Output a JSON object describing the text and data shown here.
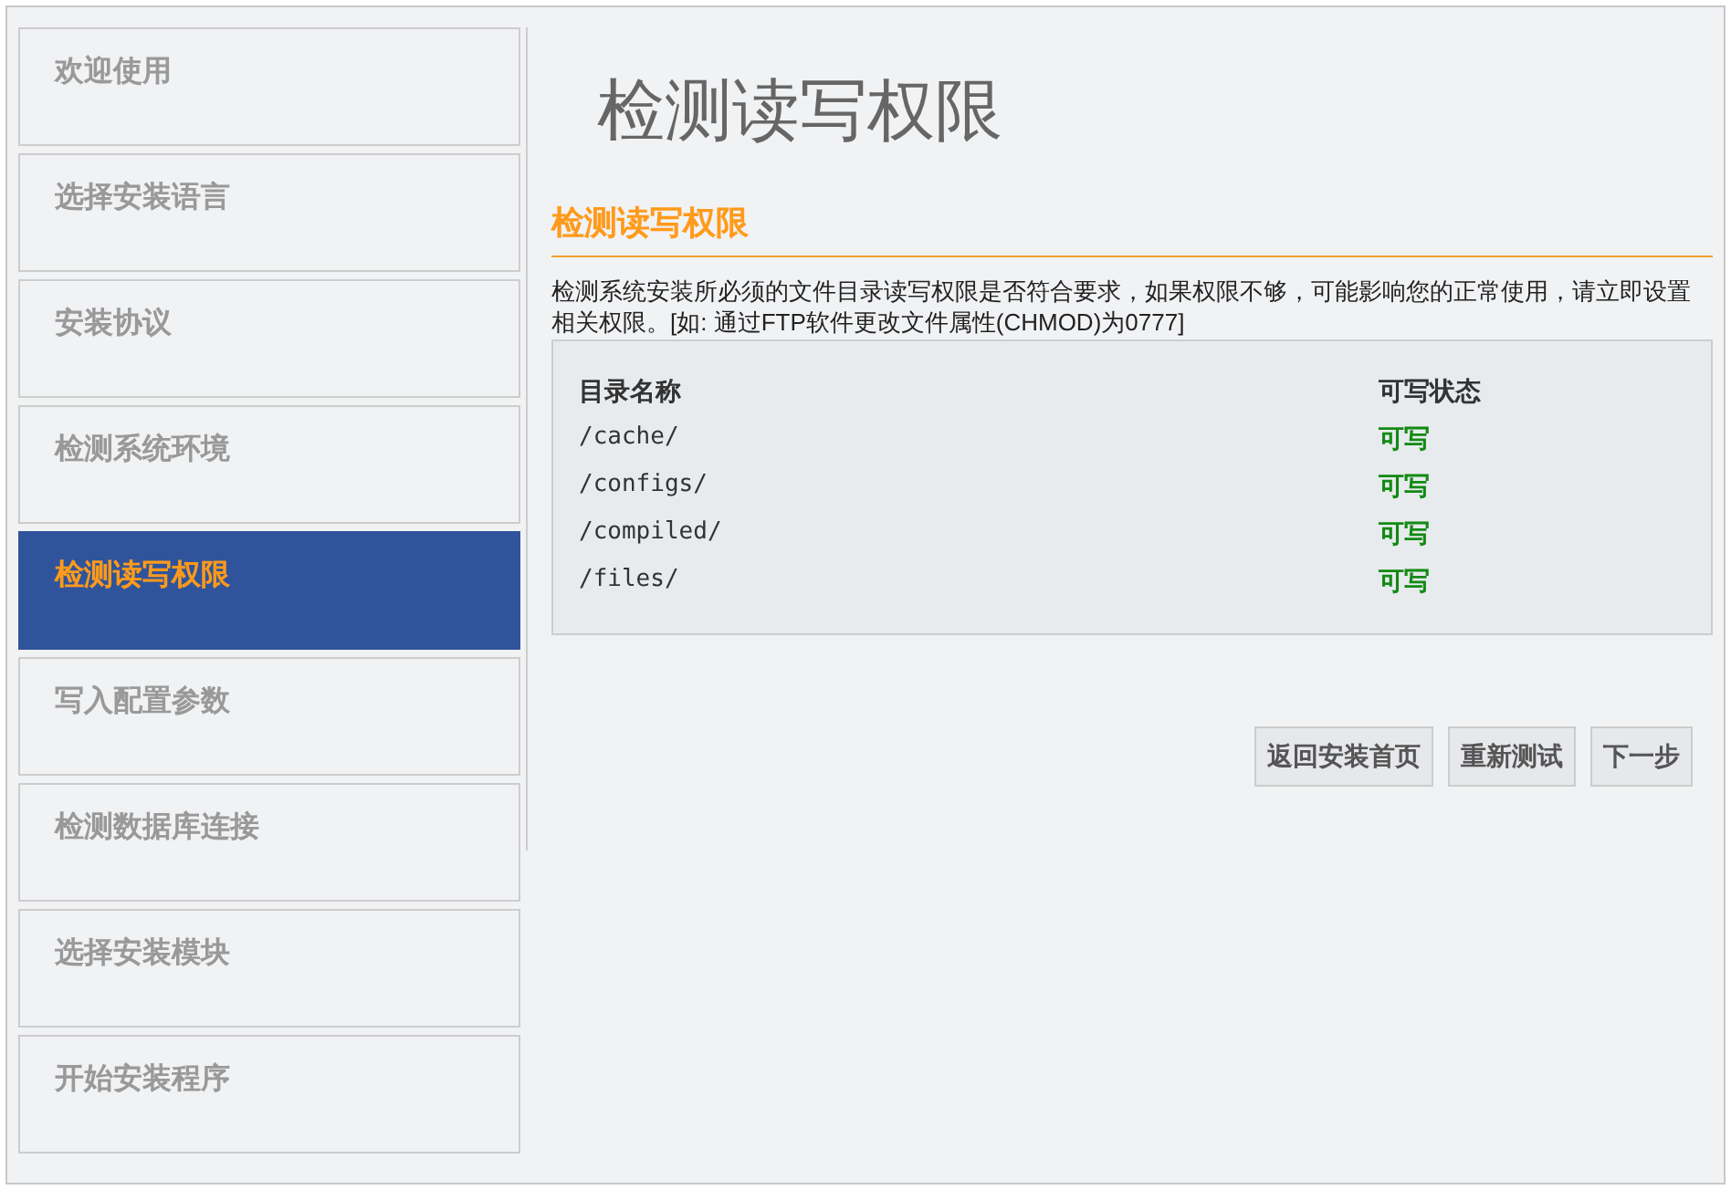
{
  "sidebar": {
    "items": [
      {
        "label": "欢迎使用",
        "selected": false
      },
      {
        "label": "选择安装语言",
        "selected": false
      },
      {
        "label": "安装协议",
        "selected": false
      },
      {
        "label": "检测系统环境",
        "selected": false
      },
      {
        "label": "检测读写权限",
        "selected": true
      },
      {
        "label": "写入配置参数",
        "selected": false
      },
      {
        "label": "检测数据库连接",
        "selected": false
      },
      {
        "label": "选择安装模块",
        "selected": false
      },
      {
        "label": "开始安装程序",
        "selected": false
      }
    ]
  },
  "page_title": "检测读写权限",
  "section": {
    "heading": "检测读写权限",
    "description": "检测系统安装所必须的文件目录读写权限是否符合要求，如果权限不够，可能影响您的正常使用，请立即设置相关权限。[如: 通过FTP软件更改文件属性(CHMOD)为0777]"
  },
  "table": {
    "columns": [
      "目录名称",
      "可写状态"
    ],
    "rows": [
      {
        "directory": "/cache/",
        "status": "可写",
        "writable": true
      },
      {
        "directory": "/configs/",
        "status": "可写",
        "writable": true
      },
      {
        "directory": "/compiled/",
        "status": "可写",
        "writable": true
      },
      {
        "directory": "/files/",
        "status": "可写",
        "writable": true
      }
    ]
  },
  "buttons": [
    "返回安装首页",
    "重新测试",
    "下一步"
  ]
}
